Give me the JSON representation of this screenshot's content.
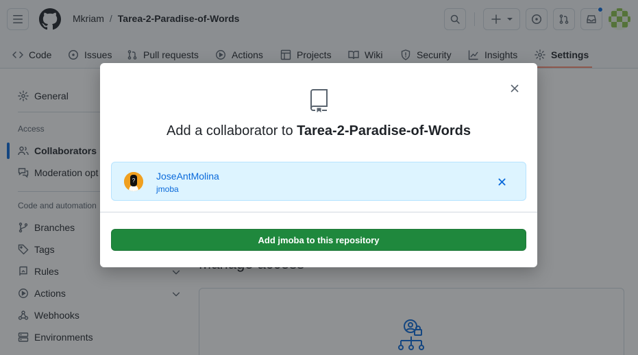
{
  "header": {
    "owner": "Mkriam",
    "separator": "/",
    "repo": "Tarea-2-Paradise-of-Words"
  },
  "tabs": [
    {
      "label": "Code",
      "icon": "code-icon"
    },
    {
      "label": "Issues",
      "icon": "issue-opened-icon"
    },
    {
      "label": "Pull requests",
      "icon": "git-pull-request-icon"
    },
    {
      "label": "Actions",
      "icon": "play-icon"
    },
    {
      "label": "Projects",
      "icon": "table-icon"
    },
    {
      "label": "Wiki",
      "icon": "book-icon"
    },
    {
      "label": "Security",
      "icon": "shield-icon"
    },
    {
      "label": "Insights",
      "icon": "graph-icon"
    },
    {
      "label": "Settings",
      "icon": "gear-icon",
      "active": true
    }
  ],
  "sidebar": {
    "general": "General",
    "access_heading": "Access",
    "collaborators": "Collaborators",
    "moderation": "Moderation opt",
    "code_heading": "Code and automation",
    "items": [
      "Branches",
      "Tags",
      "Rules",
      "Actions",
      "Webhooks",
      "Environments"
    ]
  },
  "main": {
    "manage_heading": "Manage access"
  },
  "dialog": {
    "title_prefix": "Add a collaborator to ",
    "title_repo": "Tarea-2-Paradise-of-Words",
    "selected_user": {
      "name": "JoseAntMolina",
      "login": "jmoba"
    },
    "add_button": "Add jmoba to this repository"
  },
  "colors": {
    "accent": "#0969da",
    "primary_button": "#1f883d",
    "selected_bg": "#ddf4ff",
    "active_tab_underline": "#fd8c73"
  }
}
